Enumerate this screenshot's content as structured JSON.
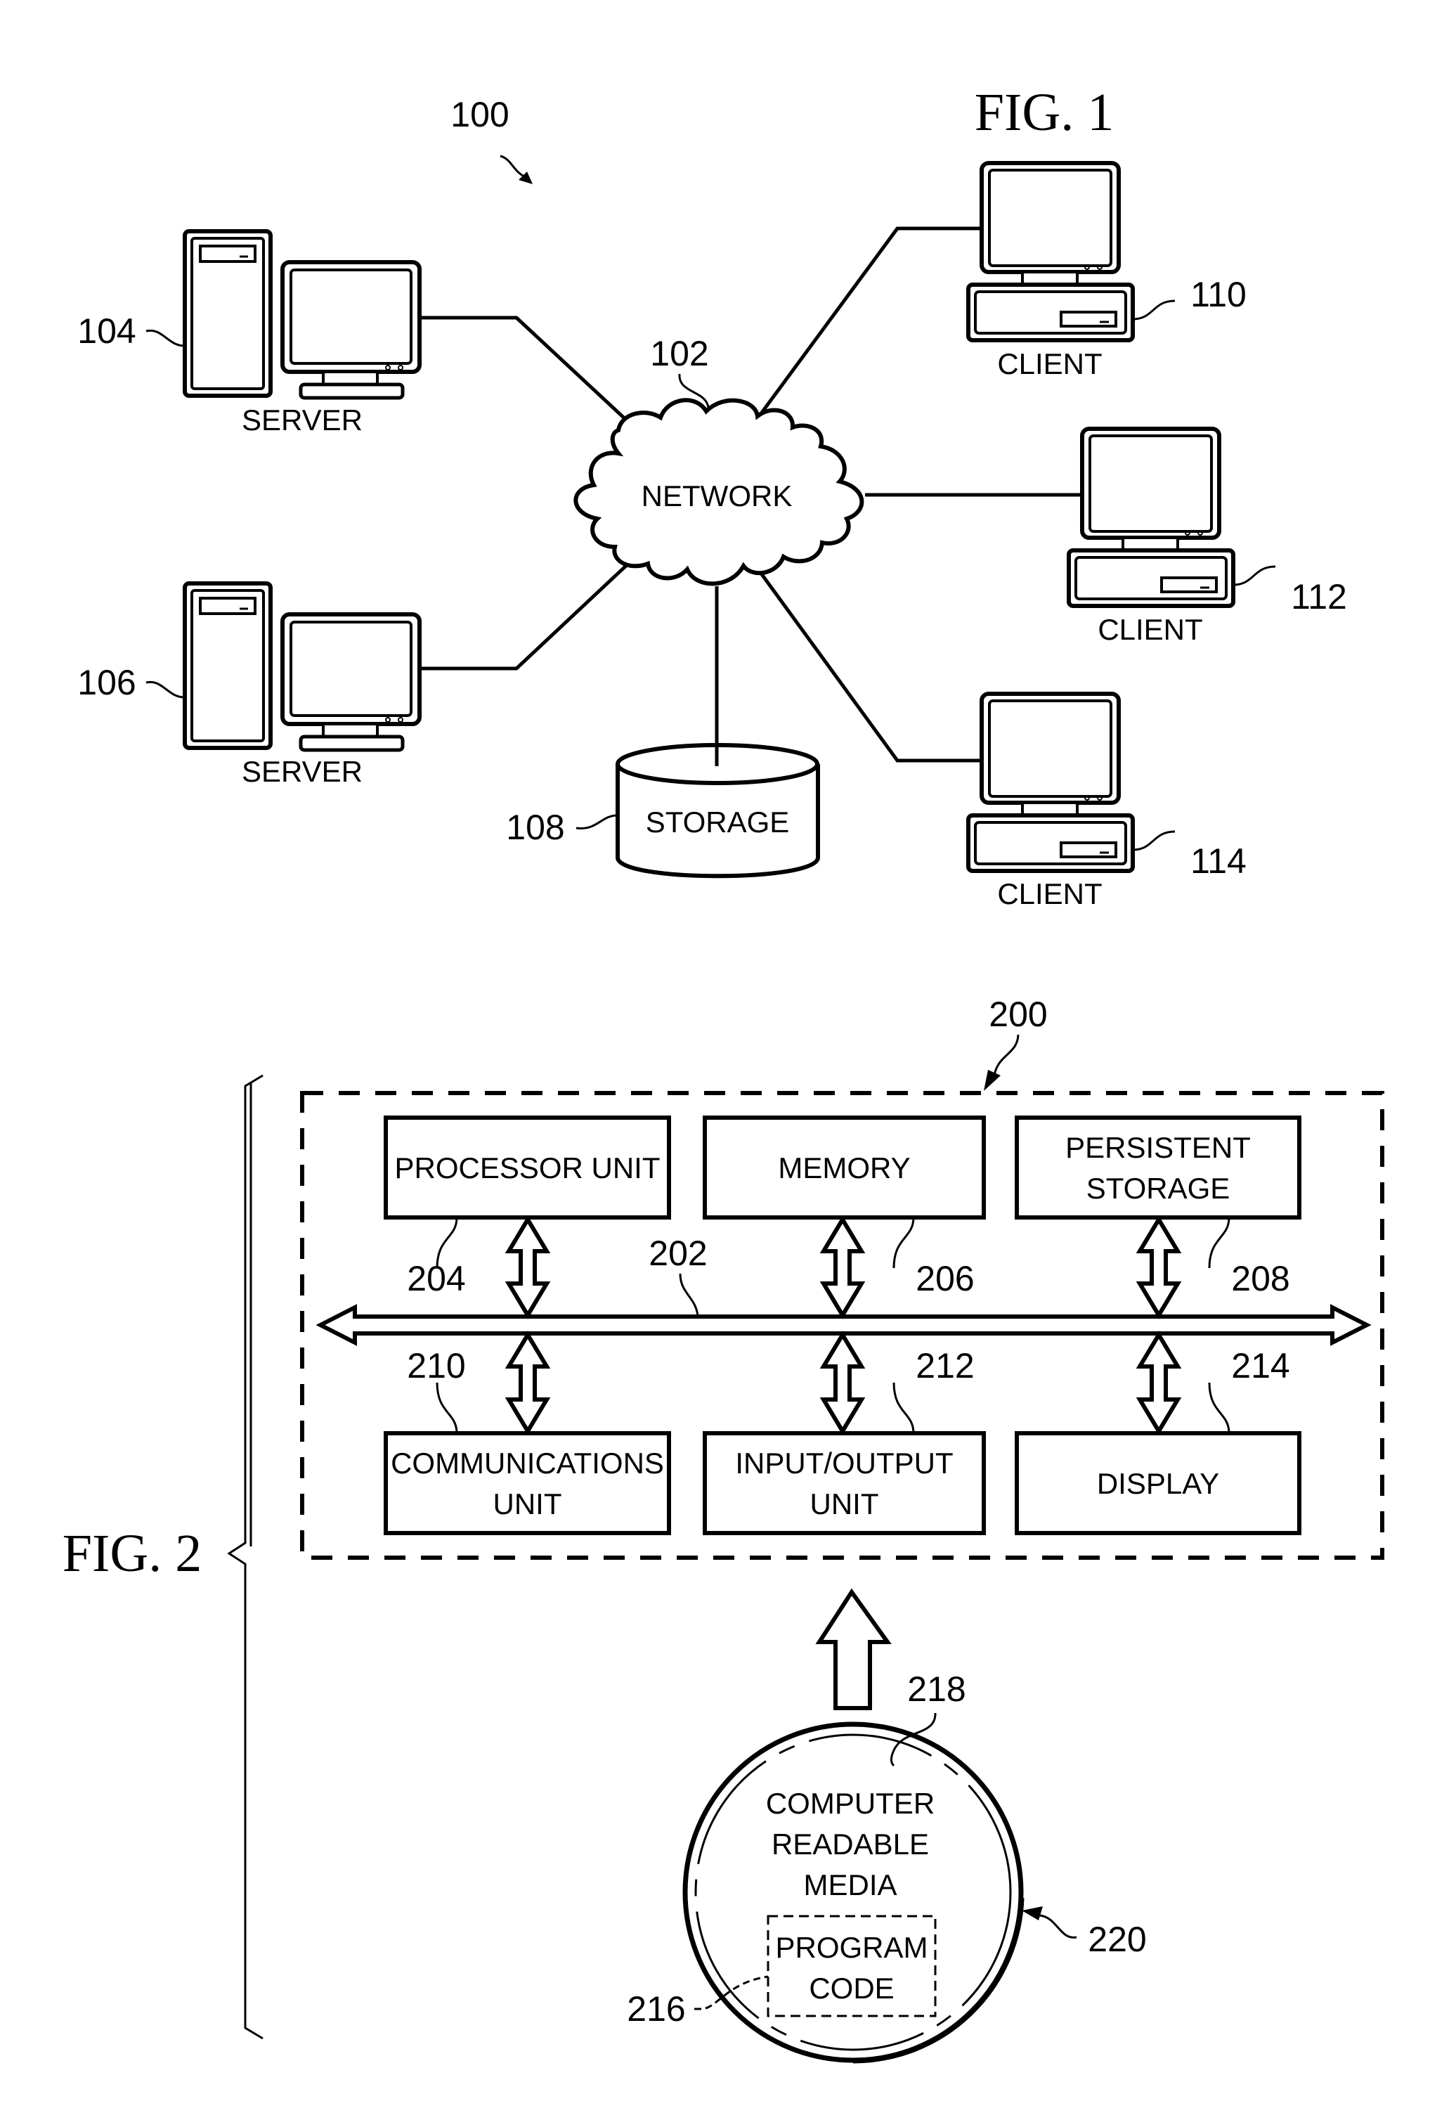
{
  "fig1": {
    "title": "FIG. 1",
    "system_ref": "100",
    "network": {
      "label": "NETWORK",
      "ref": "102"
    },
    "storage": {
      "label": "STORAGE",
      "ref": "108"
    },
    "servers": [
      {
        "label": "SERVER",
        "ref": "104"
      },
      {
        "label": "SERVER",
        "ref": "106"
      }
    ],
    "clients": [
      {
        "label": "CLIENT",
        "ref": "110"
      },
      {
        "label": "CLIENT",
        "ref": "112"
      },
      {
        "label": "CLIENT",
        "ref": "114"
      }
    ]
  },
  "fig2": {
    "title": "FIG. 2",
    "system_ref": "200",
    "bus_ref": "202",
    "top_units": [
      {
        "lines": [
          "PROCESSOR UNIT"
        ],
        "ref": "204"
      },
      {
        "lines": [
          "MEMORY"
        ],
        "ref": "206"
      },
      {
        "lines": [
          "PERSISTENT",
          "STORAGE"
        ],
        "ref": "208"
      }
    ],
    "bottom_units": [
      {
        "lines": [
          "COMMUNICATIONS",
          "UNIT"
        ],
        "ref": "210"
      },
      {
        "lines": [
          "INPUT/OUTPUT",
          "UNIT"
        ],
        "ref": "212"
      },
      {
        "lines": [
          "DISPLAY"
        ],
        "ref": "214"
      }
    ],
    "media": {
      "lines": [
        "COMPUTER",
        "READABLE",
        "MEDIA"
      ],
      "ref": "218",
      "product_ref": "220",
      "program_code": {
        "lines": [
          "PROGRAM",
          "CODE"
        ],
        "ref": "216"
      }
    }
  }
}
